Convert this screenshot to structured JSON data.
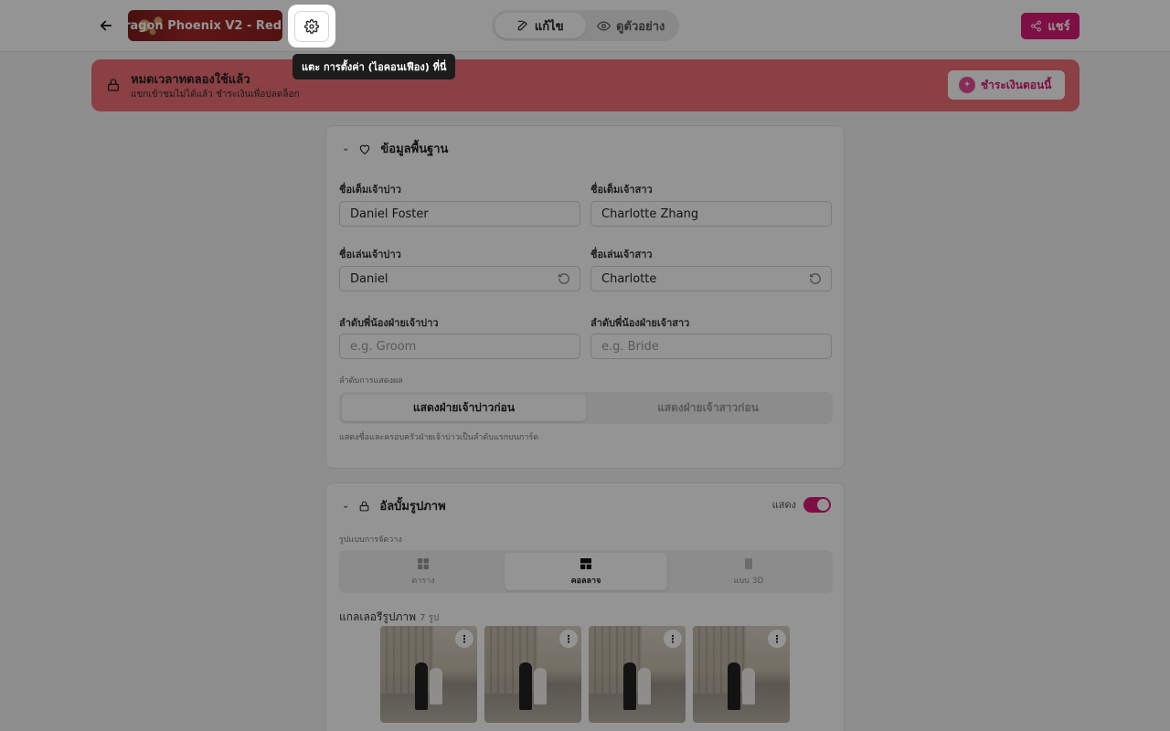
{
  "header": {
    "template_name": "ragon Phoenix V2 - Red",
    "mode_tabs": [
      {
        "label": "แก้ไข",
        "icon": "edit-icon",
        "active": true
      },
      {
        "label": "ดูตัวอย่าง",
        "icon": "eye-icon",
        "active": false
      }
    ],
    "share_label": "แชร์"
  },
  "tooltip": {
    "text": "แตะ การตั้งค่า (ไอคอนเฟือง) ที่นี่"
  },
  "banner": {
    "title": "หมดเวลาทดลองใช้แล้ว",
    "subtitle": "แขกเข้าชมไม่ได้แล้ว ชำระเงินเพื่อปลดล็อก",
    "pay_label": "ชำระเงินตอนนี้"
  },
  "basic_info": {
    "title": "ข้อมูลพื้นฐาน",
    "groom_full_label": "ชื่อเต็มเจ้าบ่าว",
    "groom_full_value": "Daniel Foster",
    "bride_full_label": "ชื่อเต็มเจ้าสาว",
    "bride_full_value": "Charlotte Zhang",
    "groom_nick_label": "ชื่อเล่นเจ้าบ่าว",
    "groom_nick_value": "Daniel",
    "bride_nick_label": "ชื่อเล่นเจ้าสาว",
    "bride_nick_value": "Charlotte",
    "groom_sibling_label": "ลำดับพี่น้องฝ่ายเจ้าบ่าว",
    "groom_sibling_placeholder": "e.g. Groom",
    "bride_sibling_label": "ลำดับพี่น้องฝ่ายเจ้าสาว",
    "bride_sibling_placeholder": "e.g. Bride",
    "display_order_label": "ลำดับการแสดงผล",
    "order_options": [
      "แสดงฝ่ายเจ้าบ่าวก่อน",
      "แสดงฝ่ายเจ้าสาวก่อน"
    ],
    "order_selected": 0,
    "order_hint": "แสดงชื่อและครอบครัวฝ่ายเจ้าบ่าวเป็นลำดับแรกบนการ์ด"
  },
  "album": {
    "title": "อัลบั้มรูปภาพ",
    "show_label": "แสดง",
    "show_enabled": true,
    "layout_label": "รูปแบบการจัดวาง",
    "layouts": [
      {
        "label": "ตาราง",
        "icon": "grid-icon"
      },
      {
        "label": "คอลลาจ",
        "icon": "collage-icon"
      },
      {
        "label": "แบบ 3D",
        "icon": "cube-3d-icon"
      }
    ],
    "layout_selected": 1,
    "gallery_title": "แกลเลอรีรูปภาพ",
    "gallery_count": "7 รูป",
    "photo_menu_glyph": "⋮"
  },
  "colors": {
    "accent": "#d81b78",
    "banner_bg": "#ef6f75"
  }
}
